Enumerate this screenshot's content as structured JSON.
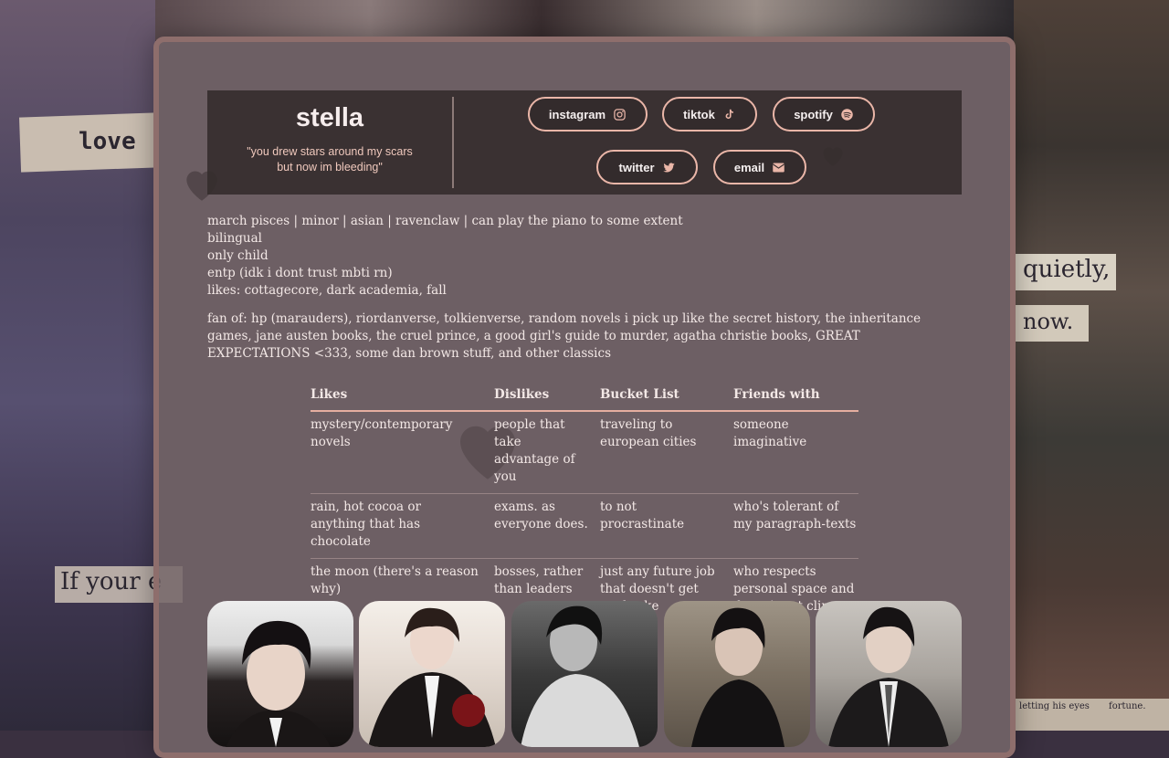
{
  "profile": {
    "name": "stella",
    "quote": "\"you drew stars around my scars but now im bleeding\""
  },
  "links": [
    {
      "label": "instagram",
      "icon": "instagram-icon"
    },
    {
      "label": "tiktok",
      "icon": "tiktok-icon"
    },
    {
      "label": "spotify",
      "icon": "spotify-icon"
    },
    {
      "label": "twitter",
      "icon": "twitter-icon"
    },
    {
      "label": "email",
      "icon": "envelope-icon"
    }
  ],
  "bio": [
    "march pisces | minor | asian | ravenclaw | can play the piano to some extent",
    "bilingual",
    "only child",
    "entp (idk i dont trust mbti rn)",
    "likes: cottagecore, dark academia, fall"
  ],
  "fan_of": "fan of: hp (marauders), riordanverse, tolkienverse, random novels i pick up like the secret history, the inheritance games, jane austen books, the cruel prince, a good girl's guide to murder, agatha christie books, GREAT EXPECTATIONS <333, some dan brown stuff, and other classics",
  "table": {
    "headers": [
      "Likes",
      "Dislikes",
      "Bucket List",
      "Friends with"
    ],
    "rows": [
      [
        "mystery/contemporary novels",
        "people that take advantage of you",
        "traveling to european cities",
        "someone imaginative"
      ],
      [
        "rain, hot cocoa or anything that has chocolate",
        "exams. as everyone does.",
        "to not procrastinate",
        "who's tolerant of my paragraph-texts"
      ],
      [
        "the moon (there's a reason why)",
        "bosses, rather than leaders",
        "just any future job that doesn't get me broke",
        "who respects personal space and doesn't get clingy"
      ]
    ]
  },
  "background_texts": {
    "love": "love",
    "quietly": "quietly,",
    "now": "now.",
    "if_your": "If your e",
    "letting": "letting his eyes",
    "fortune": "fortune."
  },
  "colors": {
    "accent_pink": "#eab6a8",
    "card_border": "#8e6e6c",
    "text": "#f3e8e6"
  }
}
